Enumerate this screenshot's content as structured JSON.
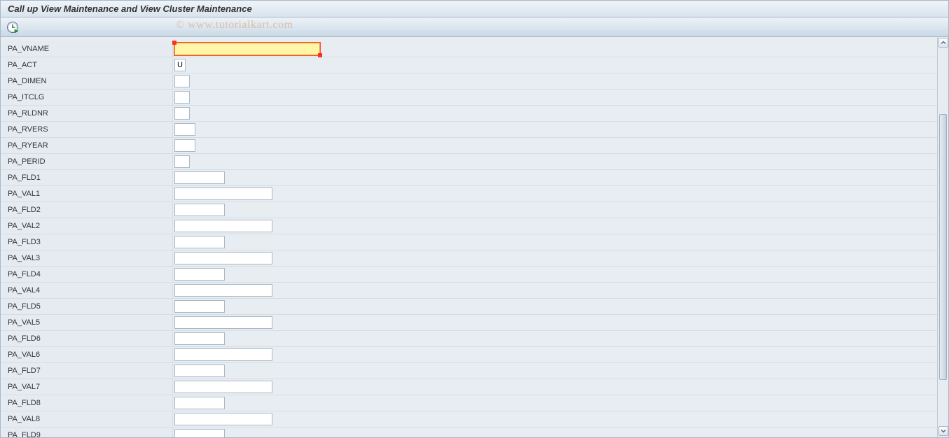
{
  "header": {
    "title": "Call up View Maintenance and View Cluster Maintenance"
  },
  "toolbar": {
    "execute_tooltip": "Execute"
  },
  "watermark": {
    "text": "© www.tutorialkart.com"
  },
  "fields": [
    {
      "label": "PA_VNAME",
      "value": "",
      "width": "w-long",
      "required": true
    },
    {
      "label": "PA_ACT",
      "value": "U",
      "width": "w-xshort",
      "required": false
    },
    {
      "label": "PA_DIMEN",
      "value": "",
      "width": "w-short",
      "required": false
    },
    {
      "label": "PA_ITCLG",
      "value": "",
      "width": "w-short",
      "required": false
    },
    {
      "label": "PA_RLDNR",
      "value": "",
      "width": "w-short",
      "required": false
    },
    {
      "label": "PA_RVERS",
      "value": "",
      "width": "w-medshort",
      "required": false
    },
    {
      "label": "PA_RYEAR",
      "value": "",
      "width": "w-medshort",
      "required": false
    },
    {
      "label": "PA_PERID",
      "value": "",
      "width": "w-short",
      "required": false
    },
    {
      "label": "PA_FLD1",
      "value": "",
      "width": "w-med",
      "required": false
    },
    {
      "label": "PA_VAL1",
      "value": "",
      "width": "w-medlong",
      "required": false
    },
    {
      "label": "PA_FLD2",
      "value": "",
      "width": "w-med",
      "required": false
    },
    {
      "label": "PA_VAL2",
      "value": "",
      "width": "w-medlong",
      "required": false
    },
    {
      "label": "PA_FLD3",
      "value": "",
      "width": "w-med",
      "required": false
    },
    {
      "label": "PA_VAL3",
      "value": "",
      "width": "w-medlong",
      "required": false
    },
    {
      "label": "PA_FLD4",
      "value": "",
      "width": "w-med",
      "required": false
    },
    {
      "label": "PA_VAL4",
      "value": "",
      "width": "w-medlong",
      "required": false
    },
    {
      "label": "PA_FLD5",
      "value": "",
      "width": "w-med",
      "required": false
    },
    {
      "label": "PA_VAL5",
      "value": "",
      "width": "w-medlong",
      "required": false
    },
    {
      "label": "PA_FLD6",
      "value": "",
      "width": "w-med",
      "required": false
    },
    {
      "label": "PA_VAL6",
      "value": "",
      "width": "w-medlong",
      "required": false
    },
    {
      "label": "PA_FLD7",
      "value": "",
      "width": "w-med",
      "required": false
    },
    {
      "label": "PA_VAL7",
      "value": "",
      "width": "w-medlong",
      "required": false
    },
    {
      "label": "PA_FLD8",
      "value": "",
      "width": "w-med",
      "required": false
    },
    {
      "label": "PA_VAL8",
      "value": "",
      "width": "w-medlong",
      "required": false
    },
    {
      "label": "PA_FLD9",
      "value": "",
      "width": "w-med",
      "required": false
    }
  ]
}
